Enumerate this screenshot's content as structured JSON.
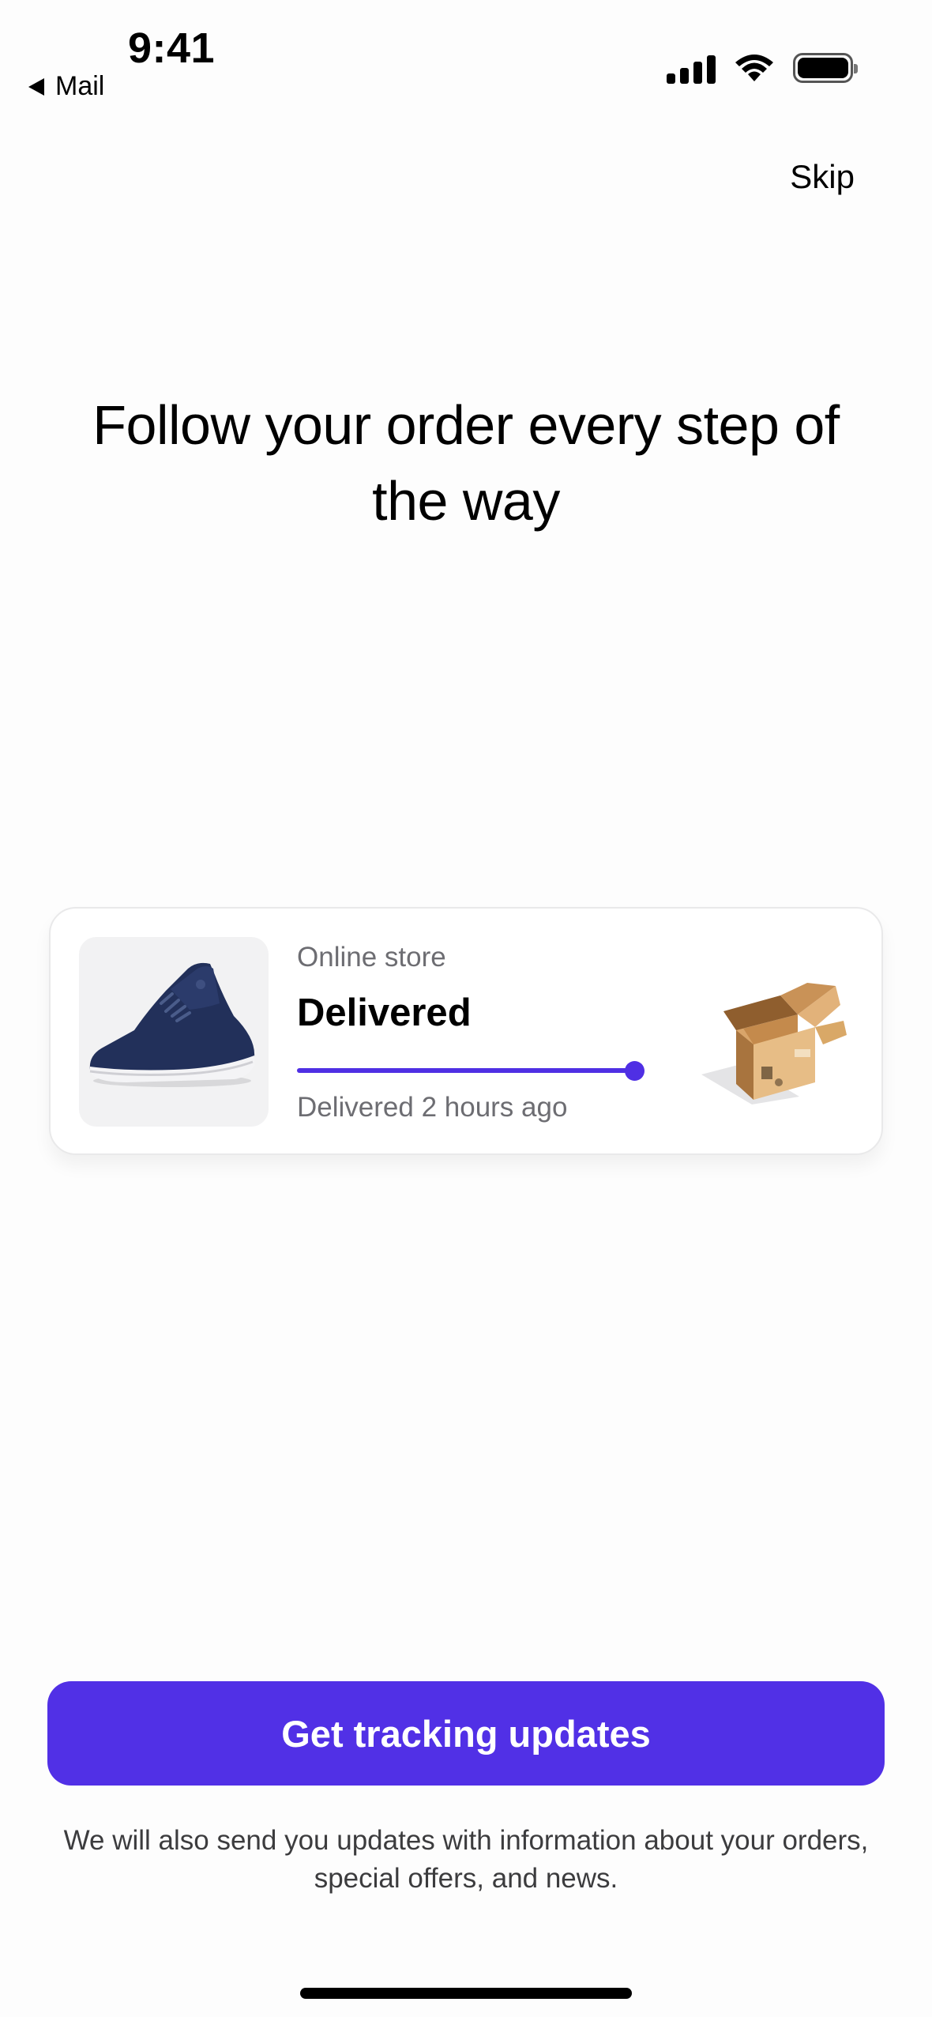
{
  "status_bar": {
    "time": "9:41",
    "back_label": "Mail",
    "icons": [
      "signal-icon",
      "wifi-icon",
      "battery-icon"
    ]
  },
  "header": {
    "skip_label": "Skip"
  },
  "main": {
    "headline": "Follow your order every step of the way"
  },
  "order_card": {
    "store": "Online store",
    "status": "Delivered",
    "progress": 1.0,
    "delivered_text": "Delivered 2 hours ago",
    "product_image": "navy-sneaker",
    "status_image": "open-cardboard-box"
  },
  "footer": {
    "cta_label": "Get tracking updates",
    "disclaimer": "We will also send you updates with information about your orders, special offers, and news."
  },
  "colors": {
    "accent": "#5130e6",
    "muted_text": "#6d6d72",
    "card_border": "#e9e9ea"
  }
}
